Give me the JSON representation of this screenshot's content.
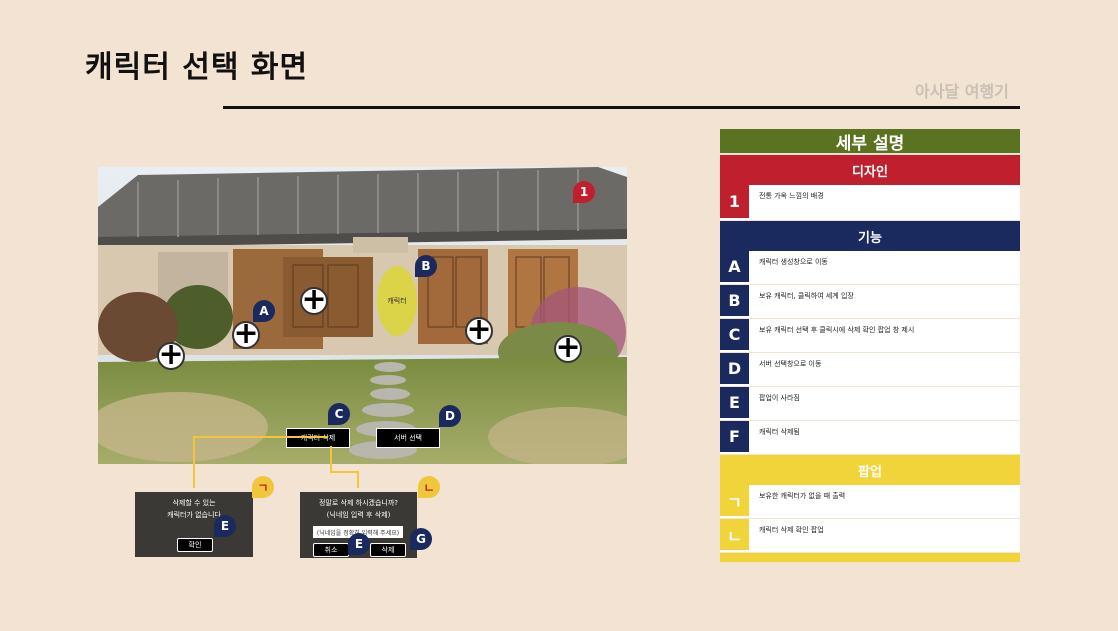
{
  "page": {
    "title": "캐릭터 선택 화면",
    "brand": "아사달 여행기"
  },
  "scene": {
    "character_label": "캐릭터",
    "delete_button": "캐릭터 삭제",
    "server_button": "서버 선택",
    "markers": {
      "one": "1",
      "a": "A",
      "b": "B",
      "c": "C",
      "d": "D"
    }
  },
  "popup1": {
    "line1": "삭제할 수 있는",
    "line2": "캐릭터가 없습니다",
    "ok": "확인",
    "marker_e": "E",
    "tag": "ㄱ"
  },
  "popup2": {
    "line1": "정말로 삭제 하시겠습니까?",
    "line2": "(닉네임 입력 후 삭제)",
    "placeholder": "(닉네임을 정확히 입력해 주세요)",
    "cancel": "취소",
    "delete": "삭제",
    "marker_e": "E",
    "marker_g": "G",
    "tag": "ㄴ"
  },
  "panel": {
    "header": "세부 설명",
    "design": {
      "title": "디자인",
      "items": [
        {
          "key": "1",
          "desc": "전통 가옥 느낌의 배경"
        }
      ]
    },
    "function": {
      "title": "기능",
      "items": [
        {
          "key": "A",
          "desc": "캐릭터 생성창으로 이동"
        },
        {
          "key": "B",
          "desc": "보유 캐릭터, 클릭하여 세계 입장"
        },
        {
          "key": "C",
          "desc": "보유 캐릭터 선택 후 클릭시에 삭제 확인 팝업 창 제시"
        },
        {
          "key": "D",
          "desc": "서버 선택창으로 이동"
        },
        {
          "key": "E",
          "desc": "팝업이 사라짐"
        },
        {
          "key": "F",
          "desc": "캐릭터 삭제됨"
        }
      ]
    },
    "popup": {
      "title": "팝업",
      "items": [
        {
          "key": "ㄱ",
          "desc": "보유한 캐릭터가 없을 때 출력"
        },
        {
          "key": "ㄴ",
          "desc": "캐릭터 삭제 확인 팝업"
        }
      ]
    }
  },
  "colors": {
    "background": "#f2e3d2",
    "green": "#5a7320",
    "red": "#c0202e",
    "navy": "#1b2a5e",
    "yellow": "#f0d43a"
  }
}
